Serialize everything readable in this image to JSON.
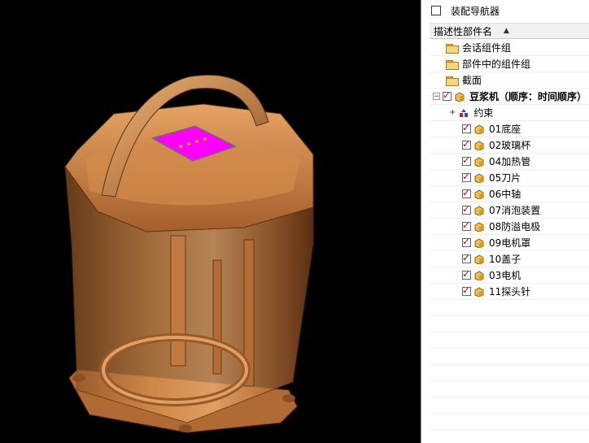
{
  "navigator": {
    "title": "装配导航器",
    "column_header": "描述性部件名",
    "sort_indicator": "▲",
    "items": [
      {
        "label": "会话组件组",
        "icon": "folder-icon"
      },
      {
        "label": "部件中的组件组",
        "icon": "folder-icon"
      },
      {
        "label": "截面",
        "icon": "folder-icon"
      },
      {
        "label": "豆浆机（顺序：时间顺序）",
        "icon": "assembly-icon",
        "expander": "−"
      },
      {
        "label": "约束",
        "icon": "constraint-icon",
        "expander": "+"
      }
    ],
    "components": [
      {
        "label": "01底座"
      },
      {
        "label": "02玻璃杯"
      },
      {
        "label": "04加热管"
      },
      {
        "label": "05刀片"
      },
      {
        "label": "06中轴"
      },
      {
        "label": "07消泡装置"
      },
      {
        "label": "08防溢电极"
      },
      {
        "label": "09电机罩"
      },
      {
        "label": "10盖子"
      },
      {
        "label": "03电机"
      },
      {
        "label": "11探头针"
      }
    ]
  },
  "colors": {
    "model": "#c8824a",
    "highlight_face": "#ff00ff",
    "checkbox_check": "#d0021b"
  }
}
